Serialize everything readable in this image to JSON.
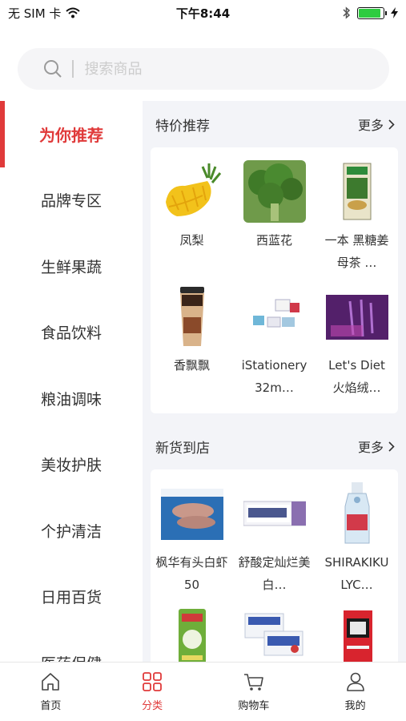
{
  "status": {
    "carrier": "无 SIM 卡",
    "time": "下午8:44",
    "battery_level": 0.9
  },
  "search": {
    "placeholder": "搜索商品"
  },
  "sidebar": {
    "items": [
      {
        "label": "为你推荐"
      },
      {
        "label": "品牌专区"
      },
      {
        "label": "生鲜果蔬"
      },
      {
        "label": "食品饮料"
      },
      {
        "label": "粮油调味"
      },
      {
        "label": "美妆护肤"
      },
      {
        "label": "个护清洁"
      },
      {
        "label": "日用百货"
      },
      {
        "label": "医药保健"
      }
    ]
  },
  "sections": [
    {
      "title": "特价推荐",
      "more": "更多",
      "products": [
        {
          "name": "凤梨"
        },
        {
          "name": "西蓝花"
        },
        {
          "name": "一本 黑糖姜母茶 …"
        },
        {
          "name": "香飘飘"
        },
        {
          "name": "iStationery 32m…"
        },
        {
          "name": "Let's Diet 火焰绒…"
        }
      ]
    },
    {
      "title": "新货到店",
      "more": "更多",
      "products": [
        {
          "name": "枫华有头白虾50"
        },
        {
          "name": "舒酸定灿烂美白…"
        },
        {
          "name": "SHIRAKIKU LYC…"
        },
        {
          "name": ""
        },
        {
          "name": ""
        },
        {
          "name": ""
        }
      ]
    }
  ],
  "tabbar": {
    "tabs": [
      {
        "label": "首页",
        "icon": "home-icon"
      },
      {
        "label": "分类",
        "icon": "category-icon"
      },
      {
        "label": "购物车",
        "icon": "cart-icon"
      },
      {
        "label": "我的",
        "icon": "profile-icon"
      }
    ]
  },
  "colors": {
    "accent": "#e03a3a",
    "content_bg": "#f3f4f8",
    "search_bg": "#f5f5f7"
  }
}
